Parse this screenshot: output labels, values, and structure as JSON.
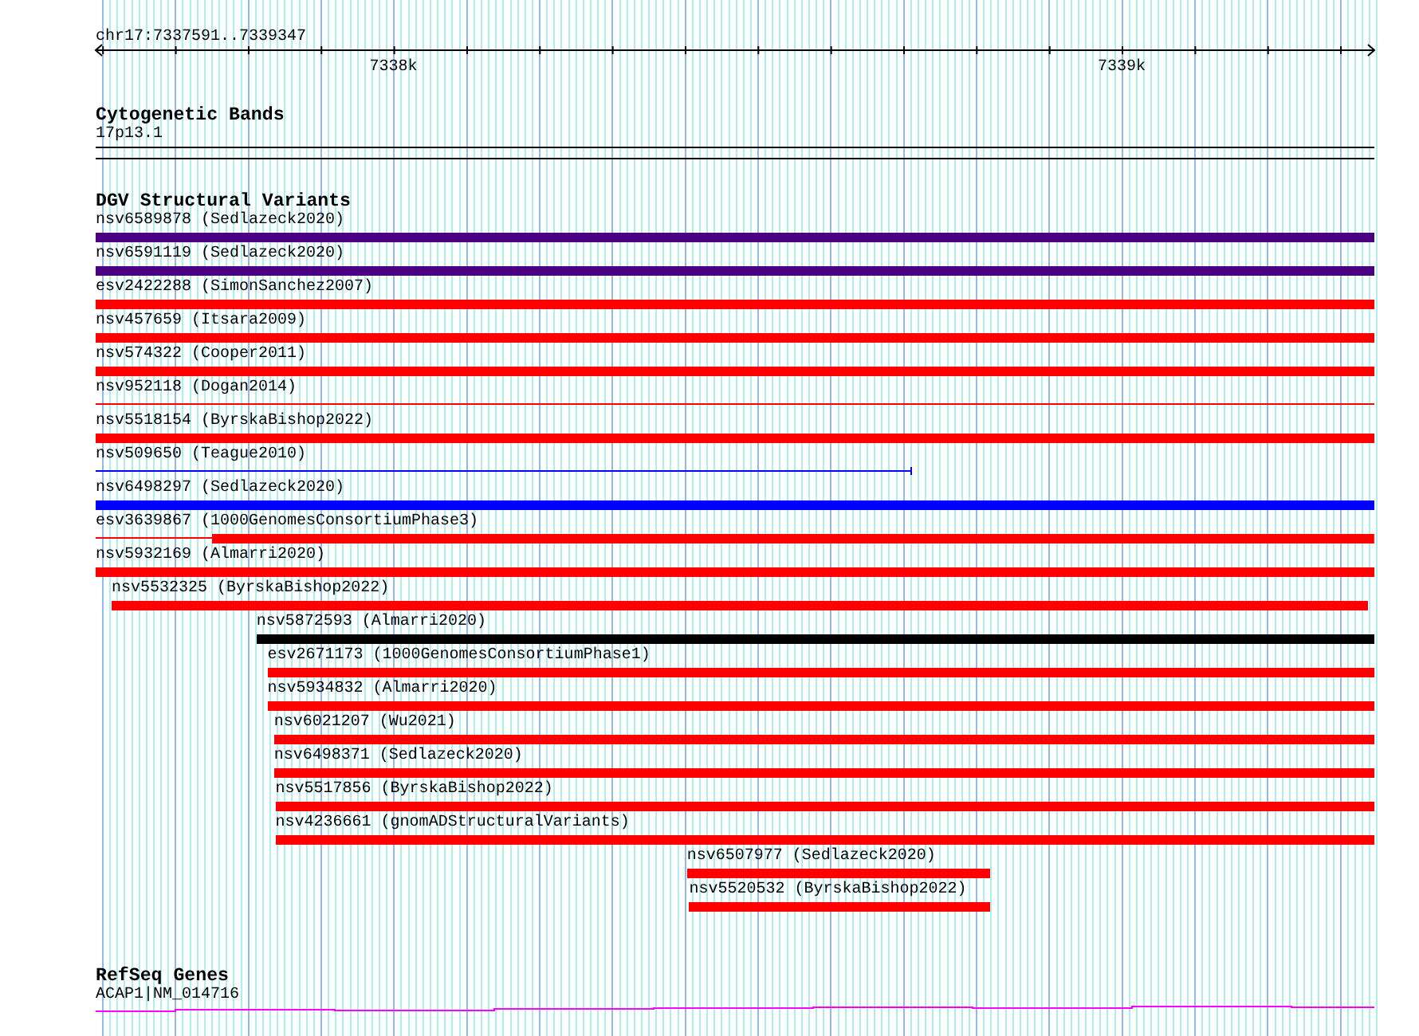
{
  "ruler": {
    "label": "chr17:7337591..7339347",
    "ticks": [
      {
        "label": "7338k"
      },
      {
        "label": "7339k"
      }
    ]
  },
  "tracks": [
    {
      "kind": "cytoband",
      "title": "Cytogenetic Bands",
      "label": "17p13.1"
    },
    {
      "kind": "variants",
      "title": "DGV Structural Variants",
      "features": [
        {
          "label": "nsv6589878 (Sedlazeck2020)",
          "kind": "thick",
          "color": "#4b0082",
          "end_tick": false
        },
        {
          "label": "nsv6591119 (Sedlazeck2020)",
          "kind": "thick",
          "color": "#4b0082",
          "end_tick": false
        },
        {
          "label": "esv2422288 (SimonSanchez2007)",
          "kind": "thick",
          "color": "#ff0000",
          "end_tick": false
        },
        {
          "label": "nsv457659 (Itsara2009)",
          "kind": "thick",
          "color": "#ff0000",
          "end_tick": false
        },
        {
          "label": "nsv574322 (Cooper2011)",
          "kind": "thick",
          "color": "#ff0000",
          "end_tick": false
        },
        {
          "label": "nsv952118 (Dogan2014)",
          "kind": "thin",
          "color": "#ff0000",
          "end_tick": false
        },
        {
          "label": "nsv5518154 (ByrskaBishop2022)",
          "kind": "thick",
          "color": "#ff0000",
          "end_tick": false
        },
        {
          "label": "nsv509650 (Teague2010)",
          "kind": "thin",
          "color": "#0000ff",
          "end_tick": true
        },
        {
          "label": "nsv6498297 (Sedlazeck2020)",
          "kind": "thick",
          "color": "#0000ff",
          "end_tick": false
        },
        {
          "label": "esv3639867 (1000GenomesConsortiumPhase3)",
          "kind": "thick",
          "color": "#ff0000",
          "end_tick": false
        },
        {
          "label": "nsv5932169 (Almarri2020)",
          "kind": "thick",
          "color": "#ff0000",
          "end_tick": false
        },
        {
          "label": "nsv5532325 (ByrskaBishop2022)",
          "kind": "thick",
          "color": "#ff0000",
          "end_tick": false
        },
        {
          "label": "nsv5872593 (Almarri2020)",
          "kind": "thick",
          "color": "#000000",
          "end_tick": false
        },
        {
          "label": "esv2671173 (1000GenomesConsortiumPhase1)",
          "kind": "thick",
          "color": "#ff0000",
          "end_tick": false
        },
        {
          "label": "nsv5934832 (Almarri2020)",
          "kind": "thick",
          "color": "#ff0000",
          "end_tick": false
        },
        {
          "label": "nsv6021207 (Wu2021)",
          "kind": "thick",
          "color": "#ff0000",
          "end_tick": false
        },
        {
          "label": "nsv6498371 (Sedlazeck2020)",
          "kind": "thick",
          "color": "#ff0000",
          "end_tick": false
        },
        {
          "label": "nsv5517856 (ByrskaBishop2022)",
          "kind": "thick",
          "color": "#ff0000",
          "end_tick": false
        },
        {
          "label": "nsv4236661 (gnomADStructuralVariants)",
          "kind": "thick",
          "color": "#ff0000",
          "end_tick": false
        },
        {
          "label": "nsv6507977 (Sedlazeck2020)",
          "kind": "thick",
          "color": "#ff0000",
          "end_tick": false
        },
        {
          "label": "nsv5520532 (ByrskaBishop2022)",
          "kind": "thick",
          "color": "#ff0000",
          "end_tick": false
        }
      ]
    },
    {
      "kind": "genes",
      "title": "RefSeq Genes",
      "features": [
        {
          "label": "ACAP1|NM_014716",
          "color": "#ff00ff"
        }
      ]
    }
  ]
}
